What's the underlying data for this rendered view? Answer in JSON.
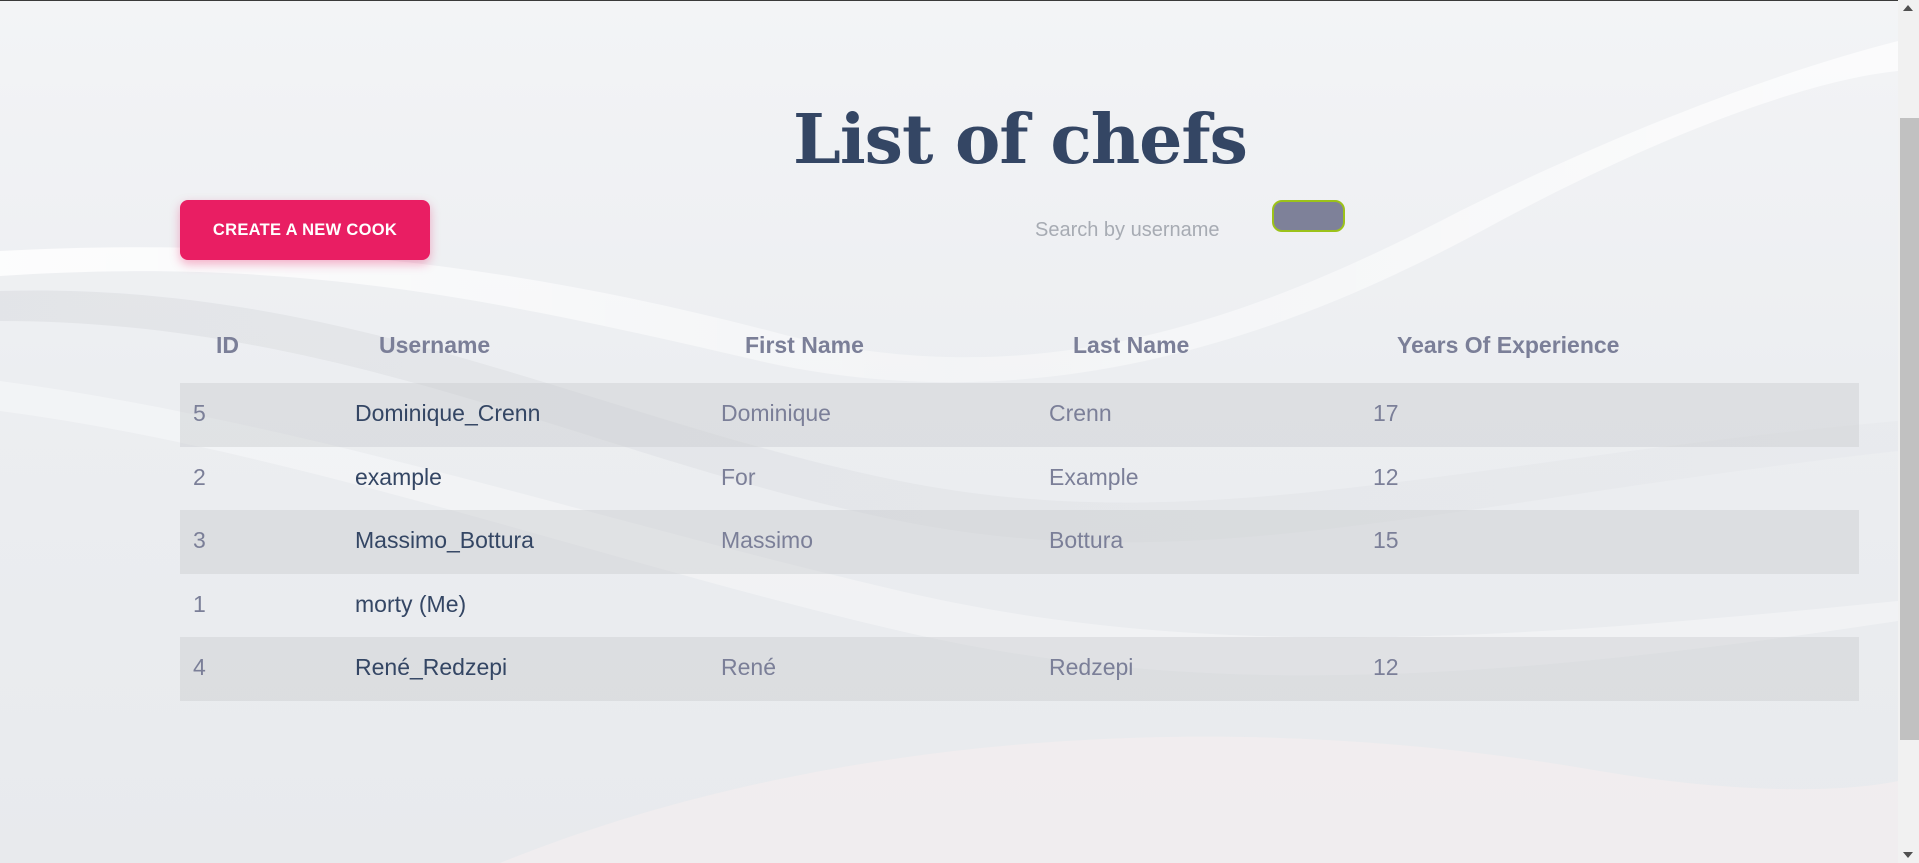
{
  "page": {
    "title": "List of chefs"
  },
  "toolbar": {
    "create_label": "CREATE A NEW COOK",
    "search_placeholder": "Search by username",
    "search_value": ""
  },
  "table": {
    "headers": [
      "ID",
      "Username",
      "First Name",
      "Last Name",
      "Years Of Experience"
    ],
    "rows": [
      {
        "id": "5",
        "username": "Dominique_Crenn",
        "first_name": "Dominique",
        "last_name": "Crenn",
        "years": "17"
      },
      {
        "id": "2",
        "username": "example",
        "first_name": "For",
        "last_name": "Example",
        "years": "12"
      },
      {
        "id": "3",
        "username": "Massimo_Bottura",
        "first_name": "Massimo",
        "last_name": "Bottura",
        "years": "15"
      },
      {
        "id": "1",
        "username": "morty (Me)",
        "first_name": "",
        "last_name": "",
        "years": ""
      },
      {
        "id": "4",
        "username": "René_Redzepi",
        "first_name": "René",
        "last_name": "Redzepi",
        "years": "12"
      }
    ]
  },
  "colors": {
    "accent": "#e91e63",
    "title": "#344664",
    "muted_text": "#7b7f98",
    "search_button": "#7e8199",
    "search_button_border": "#9cc21a"
  }
}
